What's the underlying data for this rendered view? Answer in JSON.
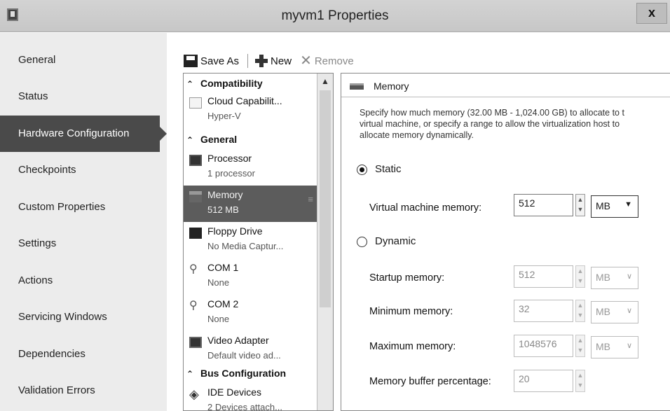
{
  "window": {
    "title": "myvm1 Properties",
    "close_glyph": "x"
  },
  "nav": {
    "items": [
      {
        "label": "General"
      },
      {
        "label": "Status"
      },
      {
        "label": "Hardware Configuration",
        "active": true
      },
      {
        "label": "Checkpoints"
      },
      {
        "label": "Custom Properties"
      },
      {
        "label": "Settings"
      },
      {
        "label": "Actions"
      },
      {
        "label": "Servicing Windows"
      },
      {
        "label": "Dependencies"
      },
      {
        "label": "Validation Errors"
      }
    ]
  },
  "toolbar": {
    "save_as": "Save As",
    "new": "New",
    "remove": "Remove"
  },
  "tree": {
    "sections": {
      "compatibility": "Compatibility",
      "general": "General",
      "bus": "Bus Configuration"
    },
    "items": {
      "cloud": {
        "title": "Cloud Capabilit...",
        "sub": "Hyper-V"
      },
      "processor": {
        "title": "Processor",
        "sub": "1 processor"
      },
      "memory": {
        "title": "Memory",
        "sub": "512 MB"
      },
      "floppy": {
        "title": "Floppy Drive",
        "sub": "No Media Captur..."
      },
      "com1": {
        "title": "COM 1",
        "sub": "None"
      },
      "com2": {
        "title": "COM 2",
        "sub": "None"
      },
      "video": {
        "title": "Video Adapter",
        "sub": "Default video ad..."
      },
      "ide": {
        "title": "IDE Devices",
        "sub": "2 Devices attach..."
      }
    }
  },
  "panel": {
    "title": "Memory",
    "description_line1": "Specify how much memory (32.00 MB - 1,024.00 GB) to allocate to t",
    "description_line2": "virtual machine, or specify a range to allow the virtualization host to",
    "description_line3": "allocate memory dynamically.",
    "static_label": "Static",
    "dynamic_label": "Dynamic",
    "mode": "static",
    "vm_memory": {
      "label": "Virtual machine memory:",
      "value": "512",
      "unit": "MB"
    },
    "startup": {
      "label": "Startup memory:",
      "value": "512",
      "unit": "MB"
    },
    "minimum": {
      "label": "Minimum memory:",
      "value": "32",
      "unit": "MB"
    },
    "maximum": {
      "label": "Maximum memory:",
      "value": "1048576",
      "unit": "MB"
    },
    "buffer": {
      "label": "Memory buffer percentage:",
      "value": "20"
    }
  }
}
